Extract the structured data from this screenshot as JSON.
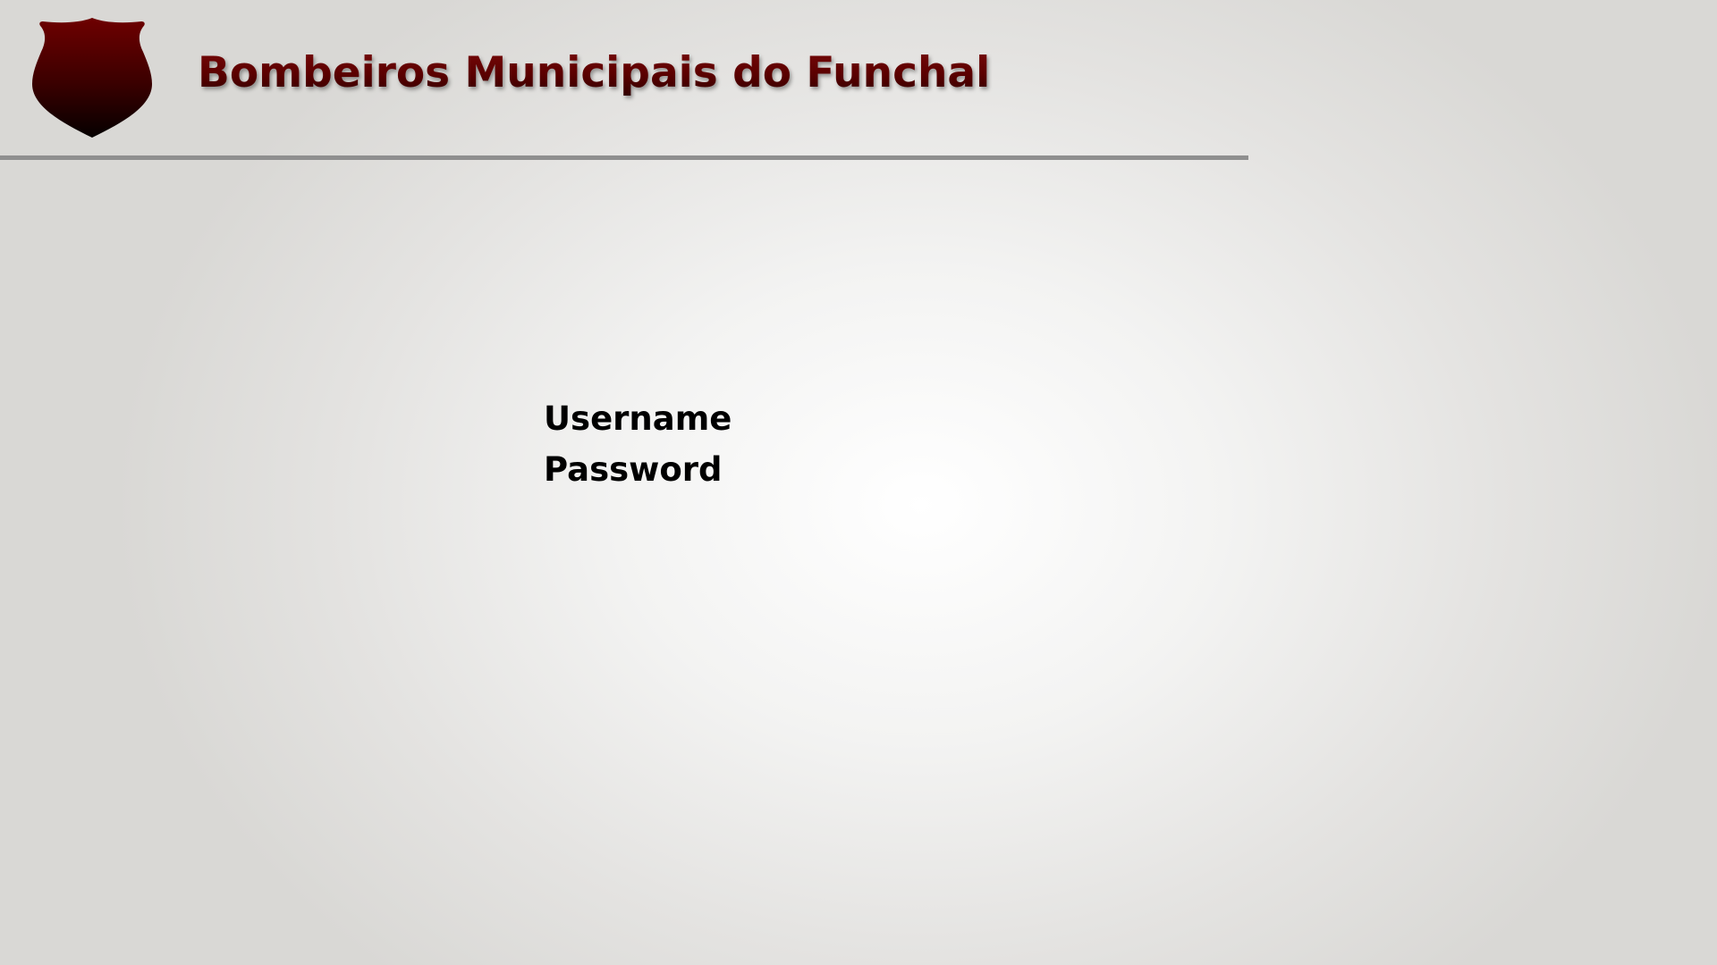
{
  "header": {
    "logo_icon": "shield-icon",
    "title": "Bombeiros Municipais do Funchal",
    "title_color_top": "#7a0a0a",
    "title_color_bottom": "#2a0000"
  },
  "login": {
    "username_label": "Username",
    "username_value": "",
    "password_label": "Password",
    "password_value": ""
  },
  "colors": {
    "background_center": "#ffffff",
    "background_edge": "#d9d8d5",
    "divider": "#8f8f8f",
    "logo_top": "#6e0000",
    "logo_bottom": "#050000",
    "label_text": "#000000"
  }
}
